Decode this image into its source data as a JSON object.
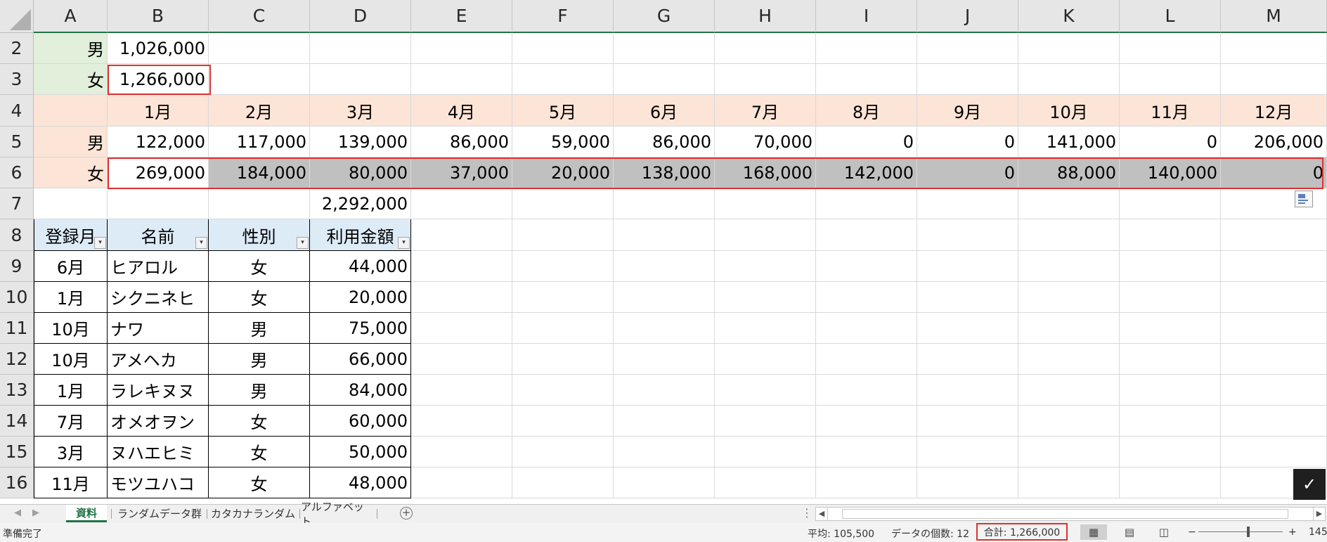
{
  "columns": [
    "A",
    "B",
    "C",
    "D",
    "E",
    "F",
    "G",
    "H",
    "I",
    "J",
    "K",
    "L",
    "M"
  ],
  "rows": [
    "2",
    "3",
    "4",
    "5",
    "6",
    "7",
    "8",
    "9",
    "10",
    "11",
    "12",
    "13",
    "14",
    "15",
    "16"
  ],
  "summary": {
    "male_label": "男",
    "male_total": "1,026,000",
    "female_label": "女",
    "female_total": "1,266,000"
  },
  "months": [
    "1月",
    "2月",
    "3月",
    "4月",
    "5月",
    "6月",
    "7月",
    "8月",
    "9月",
    "10月",
    "11月",
    "12月"
  ],
  "monthly": {
    "male_label": "男",
    "male_values": [
      "122,000",
      "117,000",
      "139,000",
      "86,000",
      "59,000",
      "86,000",
      "70,000",
      "0",
      "0",
      "141,000",
      "0",
      "206,000"
    ],
    "female_label": "女",
    "female_values": [
      "269,000",
      "184,000",
      "80,000",
      "37,000",
      "20,000",
      "138,000",
      "168,000",
      "142,000",
      "0",
      "88,000",
      "140,000",
      "0"
    ]
  },
  "grand_total": "2,292,000",
  "table": {
    "headers": [
      "登録月",
      "名前",
      "性別",
      "利用金額"
    ],
    "rows": [
      [
        "6月",
        "ヒアロル",
        "女",
        "44,000"
      ],
      [
        "1月",
        "シクニネヒ",
        "女",
        "20,000"
      ],
      [
        "10月",
        "ナワ",
        "男",
        "75,000"
      ],
      [
        "10月",
        "アメヘカ",
        "男",
        "66,000"
      ],
      [
        "1月",
        "ラレキヌヌ",
        "男",
        "84,000"
      ],
      [
        "7月",
        "オメオヲン",
        "女",
        "60,000"
      ],
      [
        "3月",
        "ヌハエヒミ",
        "女",
        "50,000"
      ],
      [
        "11月",
        "モツユハコ",
        "女",
        "48,000"
      ]
    ]
  },
  "sheet_tabs": [
    "資料",
    "ランダムデータ群",
    "カタカナランダム",
    "アルファベット"
  ],
  "active_tab": "資料",
  "status": {
    "ready": "準備完了",
    "average": "平均: 105,500",
    "count": "データの個数: 12",
    "sum": "合計: 1,266,000",
    "zoom": "145"
  },
  "icons": {
    "check": "✓",
    "add_sheet": "+",
    "normal_view": "grid-icon",
    "page_layout": "page-layout-icon",
    "page_break": "page-break-icon"
  },
  "colors": {
    "accent": "#217346",
    "highlight": "#e03030",
    "green_fill": "#e2efda",
    "peach_fill": "#fce4d6",
    "blue_fill": "#ddebf7",
    "selection_fill": "#c0c0c0"
  }
}
